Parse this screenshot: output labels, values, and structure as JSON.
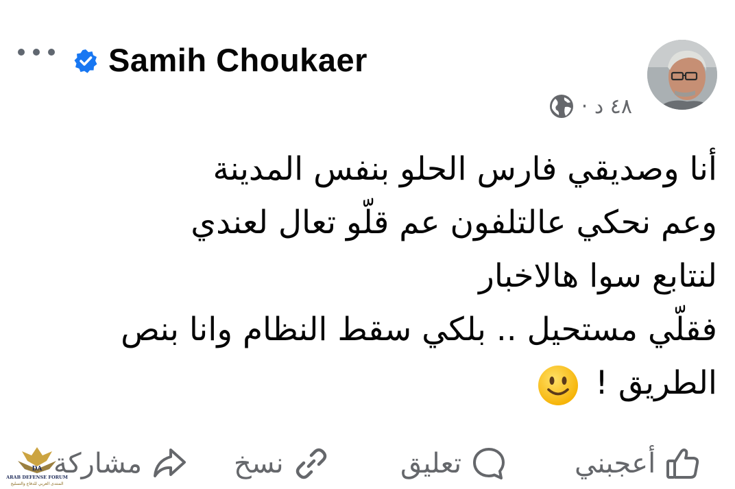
{
  "post": {
    "author": "Samih Choukaer",
    "timestamp": "٤٨ د",
    "separator": "·",
    "privacy_icon": "globe-icon",
    "verified_icon": "verified-badge-icon",
    "more_icon": "more-dots-icon",
    "lines": [
      "أنا وصديقي فارس الحلو بنفس المدينة",
      "وعم نحكي عالتلفون عم قلّو تعال لعندي",
      "لنتابع سوا هالاخبار",
      "فقلّي مستحيل .. بلكي سقط النظام وانا بنص",
      "الطريق !"
    ],
    "emoji": "slightly-smiling-face"
  },
  "actions": {
    "like": "أعجبني",
    "comment": "تعليق",
    "copy": "نسخ",
    "share": "مشاركة"
  },
  "watermark": {
    "name": "ARAB DEFENSE FORUM",
    "arabic": "المنتدى العربي للدفاع والتسليح"
  },
  "colors": {
    "text": "#050505",
    "secondary": "#65676b",
    "verified": "#1877f2"
  }
}
